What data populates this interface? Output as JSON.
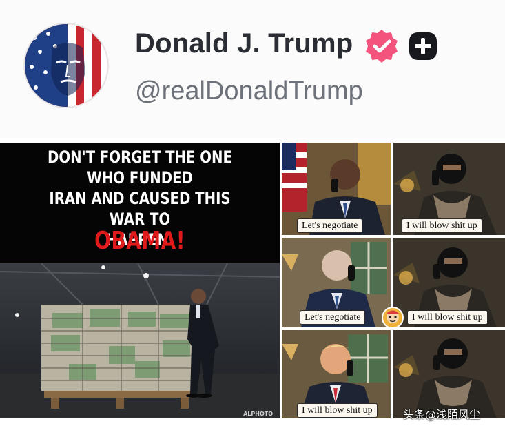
{
  "profile": {
    "display_name": "Donald J. Trump",
    "handle": "@realDonaldTrump",
    "verified_color": "#f2547d",
    "avatar_icon": "flag-portrait-avatar",
    "badge_icon": "plus-badge-icon"
  },
  "post": {
    "meme_caption_lines": [
      "DON'T FORGET THE ONE WHO FUNDED",
      "IRAN AND CAUSED THIS WAR TO",
      "HAPPEN."
    ],
    "meme_name": "OBAMA!",
    "meme_name_color": "#e0191b",
    "meme_credit": "ALPHOTO",
    "comic_bubbles": [
      "Let's negotiate",
      "I will blow shit up",
      "Let's negotiate",
      "I will blow shit up",
      "I will blow shit up",
      ""
    ]
  },
  "watermark": {
    "text": "头条@浅陌风尘"
  }
}
